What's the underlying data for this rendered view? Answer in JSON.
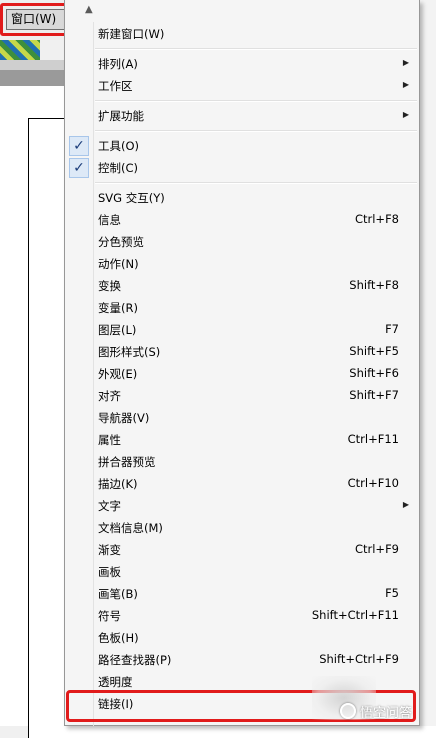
{
  "menubar": {
    "window_menu_label": "窗口(W)"
  },
  "menu": {
    "items": [
      {
        "label": "新建窗口(W)",
        "shortcut": "",
        "submenu": false,
        "checked": false
      },
      {
        "label": "排列(A)",
        "shortcut": "",
        "submenu": true,
        "checked": false
      },
      {
        "label": "工作区",
        "shortcut": "",
        "submenu": true,
        "checked": false
      },
      {
        "label": "扩展功能",
        "shortcut": "",
        "submenu": true,
        "checked": false
      },
      {
        "label": "工具(O)",
        "shortcut": "",
        "submenu": false,
        "checked": true
      },
      {
        "label": "控制(C)",
        "shortcut": "",
        "submenu": false,
        "checked": true
      },
      {
        "label": "SVG 交互(Y)",
        "shortcut": "",
        "submenu": false,
        "checked": false
      },
      {
        "label": "信息",
        "shortcut": "Ctrl+F8",
        "submenu": false,
        "checked": false
      },
      {
        "label": "分色预览",
        "shortcut": "",
        "submenu": false,
        "checked": false
      },
      {
        "label": "动作(N)",
        "shortcut": "",
        "submenu": false,
        "checked": false
      },
      {
        "label": "变换",
        "shortcut": "Shift+F8",
        "submenu": false,
        "checked": false
      },
      {
        "label": "变量(R)",
        "shortcut": "",
        "submenu": false,
        "checked": false
      },
      {
        "label": "图层(L)",
        "shortcut": "F7",
        "submenu": false,
        "checked": false
      },
      {
        "label": "图形样式(S)",
        "shortcut": "Shift+F5",
        "submenu": false,
        "checked": false
      },
      {
        "label": "外观(E)",
        "shortcut": "Shift+F6",
        "submenu": false,
        "checked": false
      },
      {
        "label": "对齐",
        "shortcut": "Shift+F7",
        "submenu": false,
        "checked": false
      },
      {
        "label": "导航器(V)",
        "shortcut": "",
        "submenu": false,
        "checked": false
      },
      {
        "label": "属性",
        "shortcut": "Ctrl+F11",
        "submenu": false,
        "checked": false
      },
      {
        "label": "拼合器预览",
        "shortcut": "",
        "submenu": false,
        "checked": false
      },
      {
        "label": "描边(K)",
        "shortcut": "Ctrl+F10",
        "submenu": false,
        "checked": false
      },
      {
        "label": "文字",
        "shortcut": "",
        "submenu": true,
        "checked": false
      },
      {
        "label": "文档信息(M)",
        "shortcut": "",
        "submenu": false,
        "checked": false
      },
      {
        "label": "渐变",
        "shortcut": "Ctrl+F9",
        "submenu": false,
        "checked": false
      },
      {
        "label": "画板",
        "shortcut": "",
        "submenu": false,
        "checked": false
      },
      {
        "label": "画笔(B)",
        "shortcut": "F5",
        "submenu": false,
        "checked": false
      },
      {
        "label": "符号",
        "shortcut": "Shift+Ctrl+F11",
        "submenu": false,
        "checked": false
      },
      {
        "label": "色板(H)",
        "shortcut": "",
        "submenu": false,
        "checked": false
      },
      {
        "label": "路径查找器(P)",
        "shortcut": "Shift+Ctrl+F9",
        "submenu": false,
        "checked": false
      },
      {
        "label": "透明度",
        "shortcut": "",
        "submenu": false,
        "checked": false
      },
      {
        "label": "链接(I)",
        "shortcut": "",
        "submenu": false,
        "checked": false
      }
    ],
    "check_glyph": "✓",
    "submenu_glyph": "▶",
    "scroll_up_glyph": "▲"
  },
  "watermark": {
    "text": "悟空问答"
  },
  "colors": {
    "highlight_frame": "#e11b1b",
    "check_bg": "#dde9f7"
  }
}
